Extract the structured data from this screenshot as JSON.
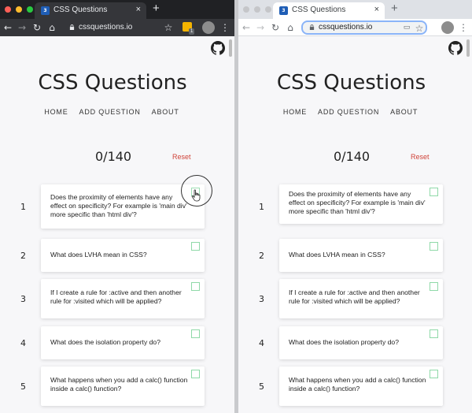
{
  "browser": {
    "tab_title": "CSS Questions",
    "tab_close": "×",
    "new_tab": "+",
    "url": "cssquestions.io",
    "extension_badge": "1",
    "buttons": {
      "back": "←",
      "forward": "→",
      "reload": "↻",
      "home": "⌂",
      "bookmark": "☆",
      "menu": "⋮"
    },
    "colors": {
      "dark_chrome": "#202124",
      "light_chrome": "#dee1e6",
      "close_light": "#ff5f57",
      "minimize_light": "#febc2e",
      "zoom_light": "#28c840"
    }
  },
  "site": {
    "title": "CSS Questions",
    "nav": [
      "HOME",
      "ADD QUESTION",
      "ABOUT"
    ],
    "score": "0/140",
    "reset_label": "Reset",
    "accent": "#d0443a",
    "check_color": "#8fd9a8"
  },
  "questions": [
    {
      "number": "1",
      "text": "Does the proximity of elements have any effect on specificity? For example is 'main div' more specific than 'html div'?"
    },
    {
      "number": "2",
      "text": "What does LVHA mean in CSS?"
    },
    {
      "number": "3",
      "text": "If I create a rule for :active and then another rule for :visited which will be applied?"
    },
    {
      "number": "4",
      "text": "What does the isolation property do?"
    },
    {
      "number": "5",
      "text": "What happens when you add a calc() function inside a calc() function?"
    }
  ]
}
